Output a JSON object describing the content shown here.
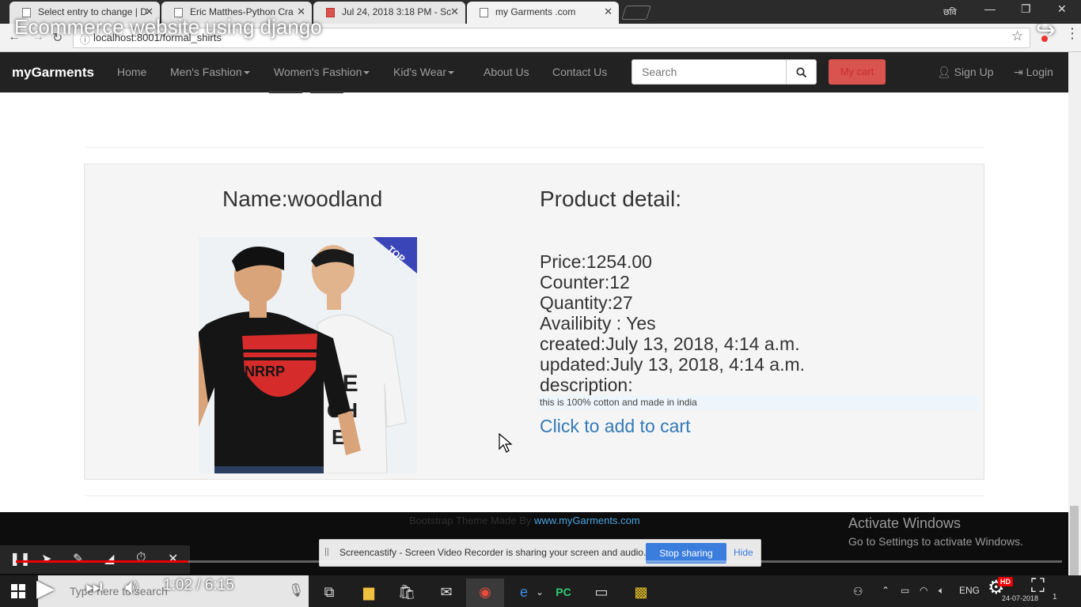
{
  "browser": {
    "tabs": [
      {
        "title": "Select entry to change | D"
      },
      {
        "title": "Eric Matthes-Python Cra"
      },
      {
        "title": "Jul 24, 2018 3:18 PM - Sc"
      },
      {
        "title": "my Garments .com"
      }
    ],
    "url": "localhost:8001/formal_shirts",
    "profile_text": "छवि"
  },
  "video": {
    "title": "Ecommerce website using django",
    "time": "1:02 / 6:15",
    "progress": 0.165,
    "hd_label": "HD"
  },
  "navbar": {
    "brand": "myGarments",
    "links": [
      "Home",
      "Men's Fashion",
      "Women's Fashion",
      "Kid's Wear",
      "About Us",
      "Contact Us"
    ],
    "search_placeholder": "Search",
    "cart_label": "My cart",
    "signup_label": "Sign Up",
    "login_label": "Login"
  },
  "product": {
    "name": "Name:woodland",
    "detail_heading": "Product detail:",
    "price": "Price:1254.00",
    "counter": "Counter:12",
    "quantity": "Quantity:27",
    "availability": "Availibity : Yes",
    "created": "created:July 13, 2018, 4:14 a.m.",
    "updated": "updated:July 13, 2018, 4:14 a.m.",
    "description_label": "description:",
    "description": "this is 100% cotton and made in india",
    "add_to_cart": "Click to add to cart",
    "badge": "TOP"
  },
  "footer": {
    "text": "Bootstrap Theme Made By",
    "link": "www.myGarments.com"
  },
  "activation": {
    "title": "Activate Windows",
    "subtitle": "Go to Settings to activate Windows."
  },
  "screencastify": {
    "message": "Screencastify - Screen Video Recorder is sharing your screen and audio.",
    "stop_label": "Stop sharing",
    "hide_label": "Hide"
  },
  "taskbar": {
    "search_placeholder": "Type here to search",
    "language": "ENG",
    "date": "24-07-2018",
    "notification_count": "1"
  }
}
